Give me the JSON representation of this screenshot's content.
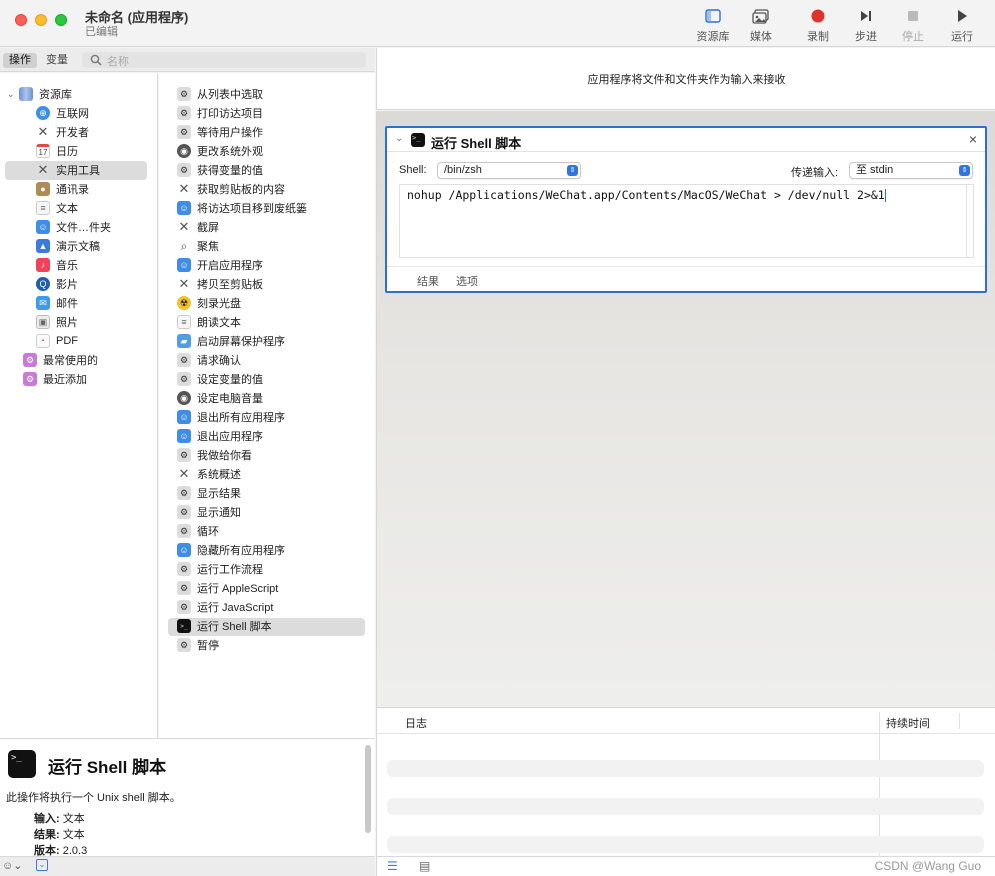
{
  "window": {
    "title": "未命名 (应用程序)",
    "subtitle": "已编辑"
  },
  "toolbar": {
    "library": "资源库",
    "media": "媒体",
    "record": "录制",
    "step": "步进",
    "stop": "停止",
    "run": "运行"
  },
  "left_header": {
    "tab_actions": "操作",
    "tab_variables": "变量",
    "search_placeholder": "名称"
  },
  "library": {
    "root": "资源库",
    "items": [
      "互联网",
      "开发者",
      "日历",
      "实用工具",
      "通讯录",
      "文本",
      "文件…件夹",
      "演示文稿",
      "音乐",
      "影片",
      "邮件",
      "照片",
      "PDF"
    ],
    "calendar_day": "17",
    "selected": "实用工具",
    "extra": [
      "最常使用的",
      "最近添加"
    ]
  },
  "actions": {
    "items": [
      "从列表中选取",
      "打印访达项目",
      "等待用户操作",
      "更改系统外观",
      "获得变量的值",
      "获取剪贴板的内容",
      "将访达项目移到废纸篓",
      "截屏",
      "聚焦",
      "开启应用程序",
      "拷贝至剪贴板",
      "刻录光盘",
      "朗读文本",
      "启动屏幕保护程序",
      "请求确认",
      "设定变量的值",
      "设定电脑音量",
      "退出所有应用程序",
      "退出应用程序",
      "我做给你看",
      "系统概述",
      "显示结果",
      "显示通知",
      "循环",
      "隐藏所有应用程序",
      "运行工作流程",
      "运行 AppleScript",
      "运行 JavaScript",
      "运行 Shell 脚本",
      "暂停"
    ],
    "selected": "运行 Shell 脚本"
  },
  "description": {
    "title": "运行 Shell 脚本",
    "text": "此操作将执行一个 Unix shell 脚本。",
    "input_key": "输入:",
    "input_val": "文本",
    "result_key": "结果:",
    "result_val": "文本",
    "version_key": "版本:",
    "version_val": "2.0.3"
  },
  "workflow": {
    "header_message": "应用程序将文件和文件夹作为输入来接收",
    "card": {
      "title": "运行 Shell 脚本",
      "shell_label": "Shell:",
      "shell_value": "/bin/zsh",
      "pass_input_label": "传递输入:",
      "pass_input_value": "至 stdin",
      "script": "nohup /Applications/WeChat.app/Contents/MacOS/WeChat > /dev/null 2>&1",
      "tab_results": "结果",
      "tab_options": "选项",
      "close": "×",
      "terminal_glyph": ">_"
    }
  },
  "log": {
    "col_log": "日志",
    "col_duration": "持续时间"
  },
  "watermark": "CSDN @Wang Guo",
  "colors": {
    "accent": "#2c6fd1",
    "record": "#e0322b"
  }
}
